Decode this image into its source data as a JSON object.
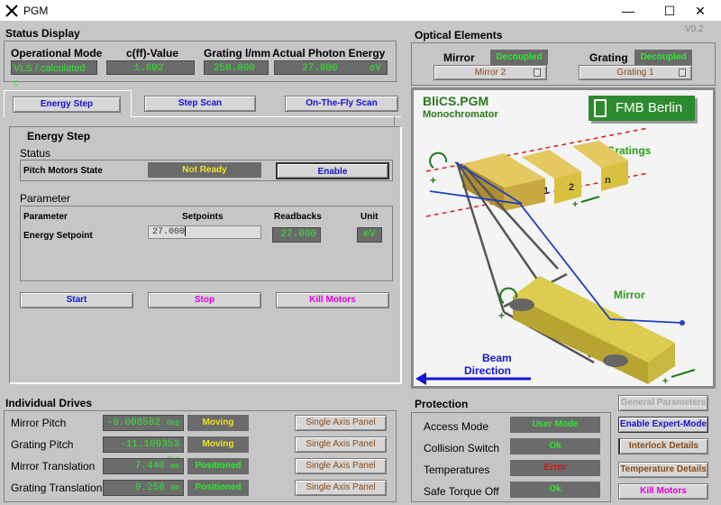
{
  "window": {
    "title": "PGM",
    "version": "V0.2"
  },
  "status_display": {
    "title": "Status Display",
    "headers": [
      "Operational Mode",
      "c(ff)-Value",
      "Grating l/mm",
      "Actual Photon Energy"
    ],
    "mode": "VLS / calculated c",
    "cff": "1.602",
    "grating_lmm": "250.000",
    "photon_energy": "27.000",
    "energy_unit": "eV"
  },
  "optical": {
    "title": "Optical Elements",
    "mirror_label": "Mirror",
    "mirror_state": "Decoupled",
    "mirror_select": "Mirror 2",
    "grating_label": "Grating",
    "grating_state": "Decoupled",
    "grating_select": "Grating 1"
  },
  "tabs": [
    "Energy Step",
    "Step Scan",
    "On-The-Fly Scan"
  ],
  "energy_step": {
    "title": "Energy Step",
    "status_label": "Status",
    "pitch_label": "Pitch Motors State",
    "pitch_state": "Not Ready",
    "enable_label": "Enable",
    "parameter_label": "Parameter",
    "col_parameter": "Parameter",
    "col_setpoints": "Setpoints",
    "col_readbacks": "Readbacks",
    "col_unit": "Unit",
    "row_label": "Energy Setpoint",
    "setpoint": "27.000",
    "readback": "27.000",
    "unit": "eV",
    "start": "Start",
    "stop": "Stop",
    "kill": "Kill Motors"
  },
  "diagram": {
    "title": "BliCS.PGM",
    "subtitle": "Monochromator",
    "logo": "FMB Berlin",
    "gratings_label": "Gratings",
    "mirror_label": "Mirror",
    "beam_label_1": "Beam",
    "beam_label_2": "Direction",
    "grating_nums": [
      "1",
      "2",
      "n"
    ]
  },
  "drives": {
    "title": "Individual Drives",
    "panel_label": "Single Axis Panel",
    "rows": [
      {
        "name": "Mirror Pitch",
        "value": "-9.008502",
        "unit": "deg",
        "state": "Moving"
      },
      {
        "name": "Grating Pitch",
        "value": "-11.109353",
        "unit": "deg",
        "state": "Moving"
      },
      {
        "name": "Mirror Translation",
        "value": "7.440",
        "unit": "mm",
        "state": "Positioned"
      },
      {
        "name": "Grating Translation",
        "value": "9.258",
        "unit": "mm",
        "state": "Positioned"
      }
    ]
  },
  "protection": {
    "title": "Protection",
    "rows": [
      {
        "name": "Access Mode",
        "value": "User Mode"
      },
      {
        "name": "Collision Switch",
        "value": "Ok"
      },
      {
        "name": "Temperatures",
        "value": "Error"
      },
      {
        "name": "Safe Torque Off",
        "value": "Ok"
      }
    ]
  },
  "side_buttons": {
    "general": "General Parameters",
    "expert": "Enable Expert-Mode",
    "interlock": "Interlock Details",
    "temperature": "Temperature Details",
    "kill": "Kill Motors"
  },
  "colors": {
    "led_green": "#2ee82e",
    "led_yellow": "#f0e020",
    "blue_text": "#1414d0",
    "magenta": "#e000e0",
    "error_red": "#e01010"
  }
}
